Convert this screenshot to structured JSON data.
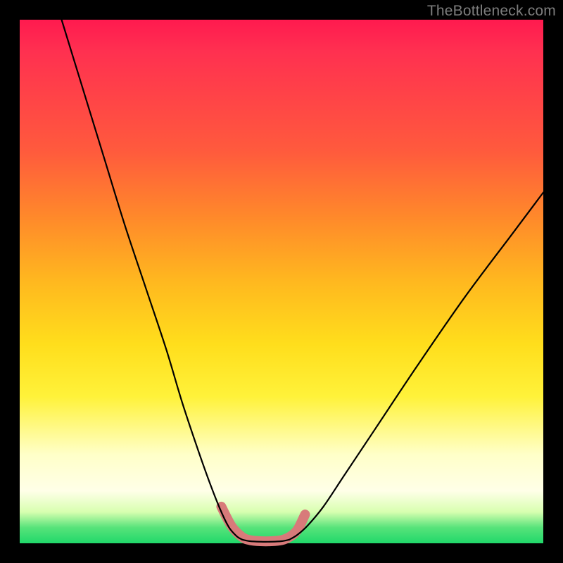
{
  "watermark": "TheBottleneck.com",
  "chart_data": {
    "type": "line",
    "title": "",
    "xlabel": "",
    "ylabel": "",
    "xlim": [
      0,
      100
    ],
    "ylim": [
      0,
      100
    ],
    "grid": false,
    "legend": null,
    "notes": "Axes, ticks and labels are not rendered in the source image; values are normalised 0–100 estimates read from pixel positions. Background is a vertical red→green gradient. A pink highlight marks the curve near its minimum.",
    "series": [
      {
        "name": "left-branch",
        "kind": "curve",
        "x": [
          8,
          12,
          16,
          20,
          24,
          28,
          31,
          34,
          36.5,
          38.5,
          40,
          41.5,
          42.5
        ],
        "y": [
          100,
          87,
          74,
          61,
          49,
          37,
          27,
          18,
          11,
          6,
          3,
          1.3,
          0.7
        ]
      },
      {
        "name": "valley-floor",
        "kind": "curve",
        "x": [
          42.5,
          44,
          46,
          48,
          50,
          51.5
        ],
        "y": [
          0.7,
          0.4,
          0.3,
          0.3,
          0.4,
          0.7
        ]
      },
      {
        "name": "right-branch",
        "kind": "curve",
        "x": [
          51.5,
          53,
          55,
          58,
          62,
          68,
          76,
          85,
          94,
          100
        ],
        "y": [
          0.7,
          1.6,
          3.4,
          7,
          13,
          22,
          34,
          47,
          59,
          67
        ]
      },
      {
        "name": "pink-highlight",
        "kind": "overlay",
        "color": "#d87a7a",
        "x": [
          38.5,
          40.5,
          42.5,
          44,
          46,
          48,
          50,
          51.5,
          53,
          54.5
        ],
        "y": [
          7,
          3.2,
          1.2,
          0.6,
          0.4,
          0.4,
          0.6,
          1.2,
          2.5,
          5.5
        ]
      }
    ]
  }
}
